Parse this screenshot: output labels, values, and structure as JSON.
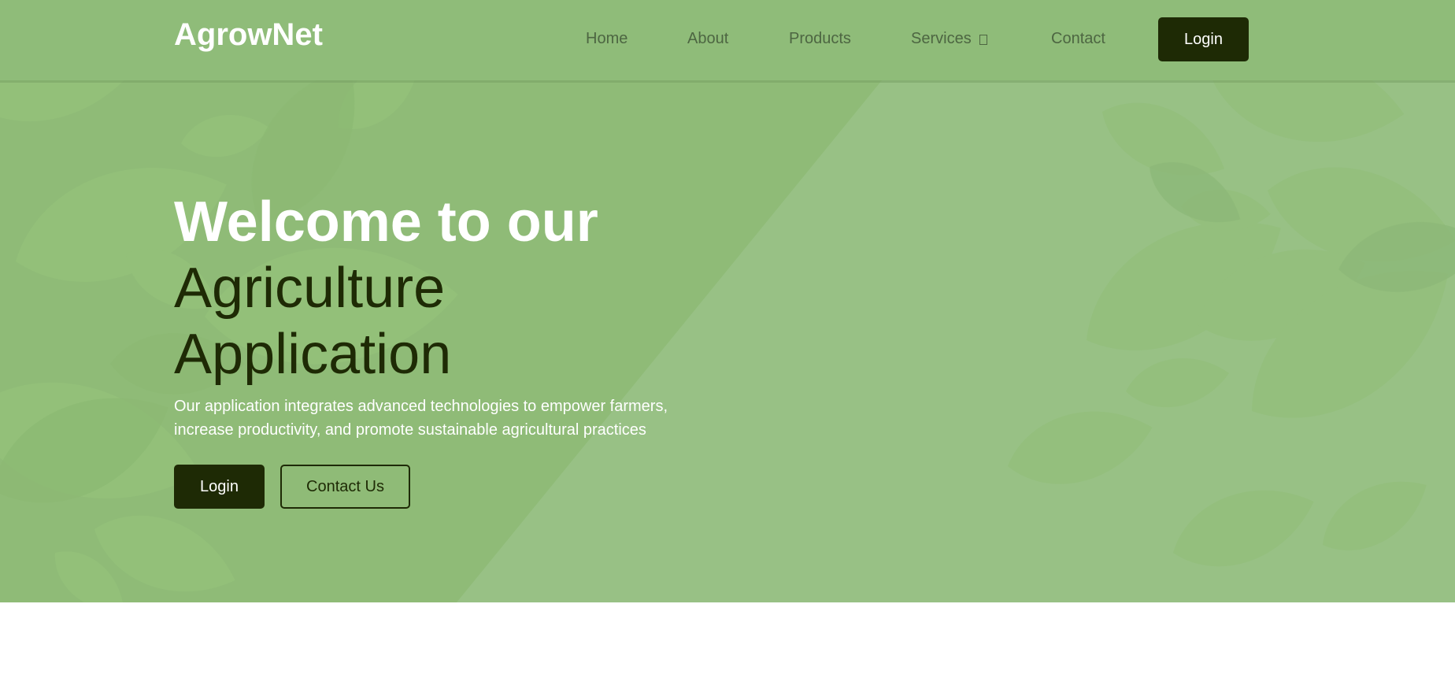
{
  "header": {
    "logo": "AgrowNet",
    "nav": [
      {
        "label": "Home"
      },
      {
        "label": "About"
      },
      {
        "label": "Products"
      },
      {
        "label": "Services",
        "dropdown_icon": "chevron-down-icon"
      },
      {
        "label": "Contact"
      }
    ],
    "login_label": "Login"
  },
  "hero": {
    "title_line1": "Welcome to our",
    "title_line2": "Agriculture",
    "title_line3": "Application",
    "description": "Our application integrates advanced technologies to empower farmers, increase productivity, and promote sustainable agricultural practices",
    "login_label": "Login",
    "contact_label": "Contact Us"
  },
  "colors": {
    "header_bg": "#8fbc79",
    "hero_bg": "#98c185",
    "button_dark": "#1e2a05",
    "nav_text": "#4d6642",
    "white": "#ffffff"
  }
}
